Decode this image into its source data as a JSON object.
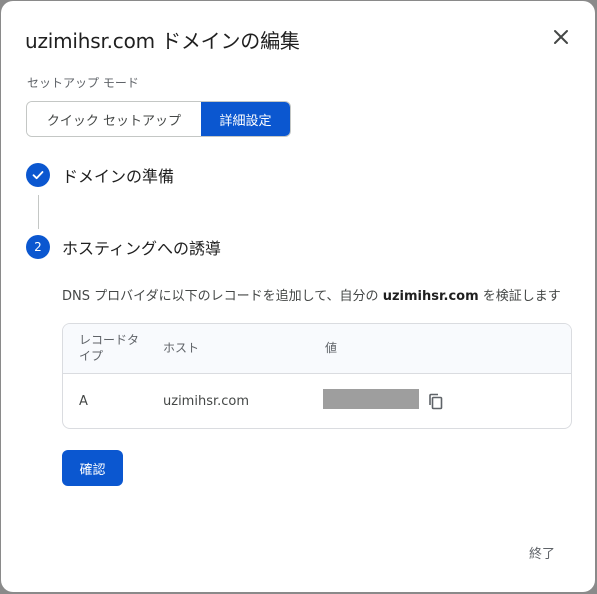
{
  "dialog": {
    "title": "uzimihsr.com ドメインの編集",
    "close_icon": "close-icon"
  },
  "setup_mode": {
    "label": "セットアップ モード",
    "options": [
      "クイック セットアップ",
      "詳細設定"
    ],
    "selected": "詳細設定"
  },
  "steps": [
    {
      "marker_icon": "check-icon",
      "title": "ドメインの準備",
      "state": "completed"
    },
    {
      "number": "2",
      "title": "ホスティングへの誘導",
      "state": "active"
    }
  ],
  "instruction": {
    "prefix": "DNS プロバイダに以下のレコードを追加して、自分の ",
    "domain": "uzimihsr.com",
    "suffix": " を検証します"
  },
  "records_table": {
    "headers": {
      "type": "レコードタイプ",
      "host": "ホスト",
      "value": "値"
    },
    "rows": [
      {
        "type": "A",
        "host": "uzimihsr.com",
        "value_redacted": true
      }
    ]
  },
  "actions": {
    "confirm": "確認",
    "done": "終了"
  },
  "colors": {
    "primary": "#0b57d0",
    "backdrop": "#8a8a8a",
    "redacted": "#9e9e9e"
  }
}
